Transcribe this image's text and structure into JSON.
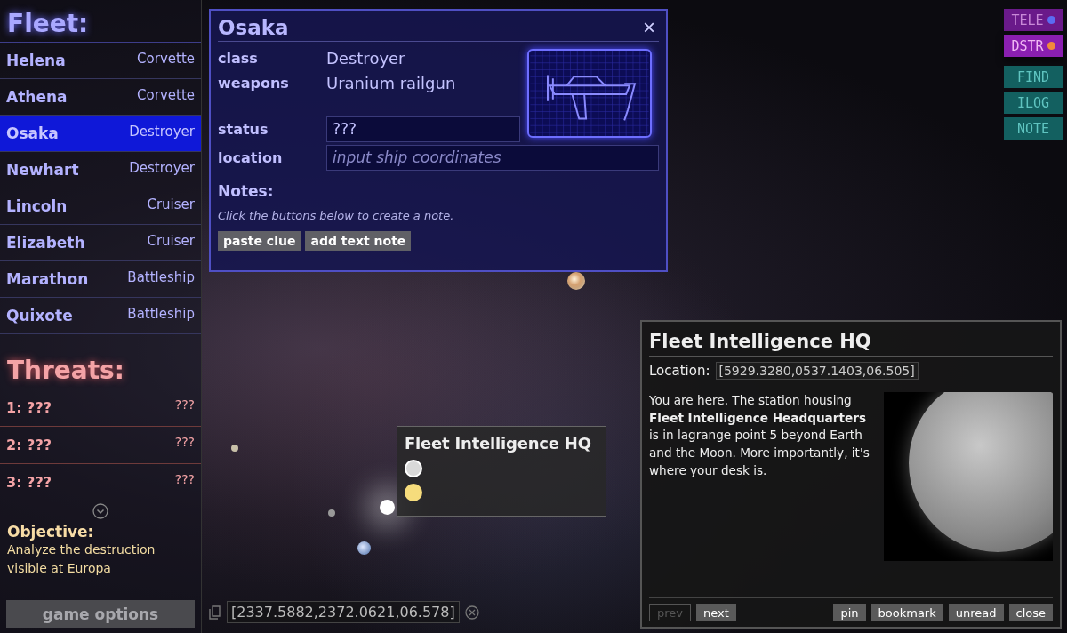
{
  "fleet": {
    "title": "Fleet:",
    "ships": [
      {
        "name": "Helena",
        "class": "Corvette",
        "selected": false
      },
      {
        "name": "Athena",
        "class": "Corvette",
        "selected": false
      },
      {
        "name": "Osaka",
        "class": "Destroyer",
        "selected": true
      },
      {
        "name": "Newhart",
        "class": "Destroyer",
        "selected": false
      },
      {
        "name": "Lincoln",
        "class": "Cruiser",
        "selected": false
      },
      {
        "name": "Elizabeth",
        "class": "Cruiser",
        "selected": false
      },
      {
        "name": "Marathon",
        "class": "Battleship",
        "selected": false
      },
      {
        "name": "Quixote",
        "class": "Battleship",
        "selected": false
      }
    ]
  },
  "threats": {
    "title": "Threats:",
    "items": [
      {
        "name": "1: ???",
        "class": "???"
      },
      {
        "name": "2: ???",
        "class": "???"
      },
      {
        "name": "3: ???",
        "class": "???"
      }
    ]
  },
  "objective": {
    "title": "Objective:",
    "text": "Analyze the destruction visible at Europa"
  },
  "game_options": "game options",
  "ship_panel": {
    "title": "Osaka",
    "close": "×",
    "fields": [
      {
        "label": "class",
        "kind": "text",
        "value": "Destroyer"
      },
      {
        "label": "weapons",
        "kind": "text",
        "value": "Uranium railgun"
      },
      {
        "label": "status",
        "kind": "input",
        "value": "???"
      },
      {
        "label": "location",
        "kind": "input",
        "placeholder": "input ship coordinates"
      }
    ],
    "notes_title": "Notes:",
    "notes_hint": "Click the buttons below to create a note.",
    "buttons": [
      "paste clue",
      "add text note"
    ]
  },
  "mode_buttons": [
    {
      "label": "TELE",
      "kind": "toggle",
      "color": "#5b6cf2",
      "selected": false
    },
    {
      "label": "DSTR",
      "kind": "toggle",
      "color": "#f08a3c",
      "selected": true
    },
    {
      "label": "FIND",
      "kind": "action"
    },
    {
      "label": "ILOG",
      "kind": "action"
    },
    {
      "label": "NOTE",
      "kind": "action"
    }
  ],
  "map": {
    "tooltip": {
      "title": "Fleet Intelligence HQ",
      "markers": [
        {
          "color": "#d9d9d9"
        },
        {
          "color": "#f6dc7c"
        }
      ]
    },
    "coordinates": "[2337.5882,2372.0621,06.578]"
  },
  "info_panel": {
    "title": "Fleet Intelligence HQ",
    "location_label": "Location:",
    "location": "[5929.3280,0537.1403,06.505]",
    "text": "You are here. The station housing **Fleet Intelligence Headquarters** is in lagrange point 5 beyond Earth and the Moon. More importantly, it's where your desk is.",
    "nav_buttons": [
      {
        "label": "prev",
        "disabled": true
      },
      {
        "label": "next",
        "disabled": false
      }
    ],
    "actions": [
      "pin",
      "bookmark",
      "unread",
      "close"
    ]
  }
}
